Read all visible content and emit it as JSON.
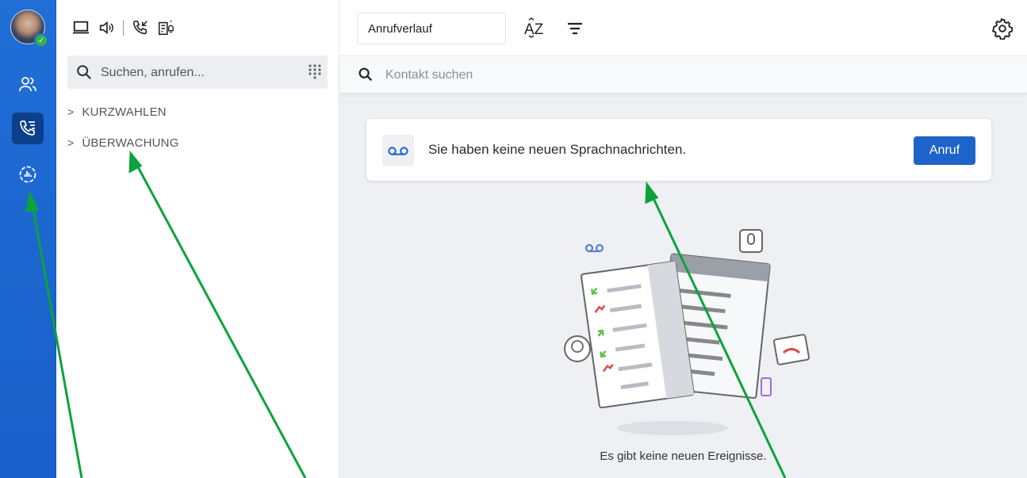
{
  "colors": {
    "rail": "#1f6fd6",
    "accent": "#1e63c9",
    "arrow": "#0ba33b",
    "status": "#32b34a"
  },
  "rail": {
    "items": [
      {
        "icon": "contacts-icon",
        "active": false
      },
      {
        "icon": "call-list-icon",
        "active": true
      },
      {
        "icon": "statistics-icon",
        "active": false
      }
    ]
  },
  "column": {
    "top_icons": [
      "computer-icon",
      "speaker-icon",
      "call-forward-icon",
      "voicemail-notify-icon"
    ],
    "search": {
      "placeholder": "Suchen, anrufen..."
    },
    "groups": [
      {
        "label": "KURZWAHLEN"
      },
      {
        "label": "ÜBERWACHUNG"
      }
    ]
  },
  "toolbar": {
    "view_select": "Anrufverlauf",
    "sort_label": "AZ"
  },
  "contact_search": {
    "placeholder": "Kontakt suchen"
  },
  "voicemail_card": {
    "message": "Sie haben keine neuen Sprachnachrichten.",
    "button": "Anruf"
  },
  "empty_state": {
    "text": "Es gibt keine neuen Ereignisse."
  }
}
